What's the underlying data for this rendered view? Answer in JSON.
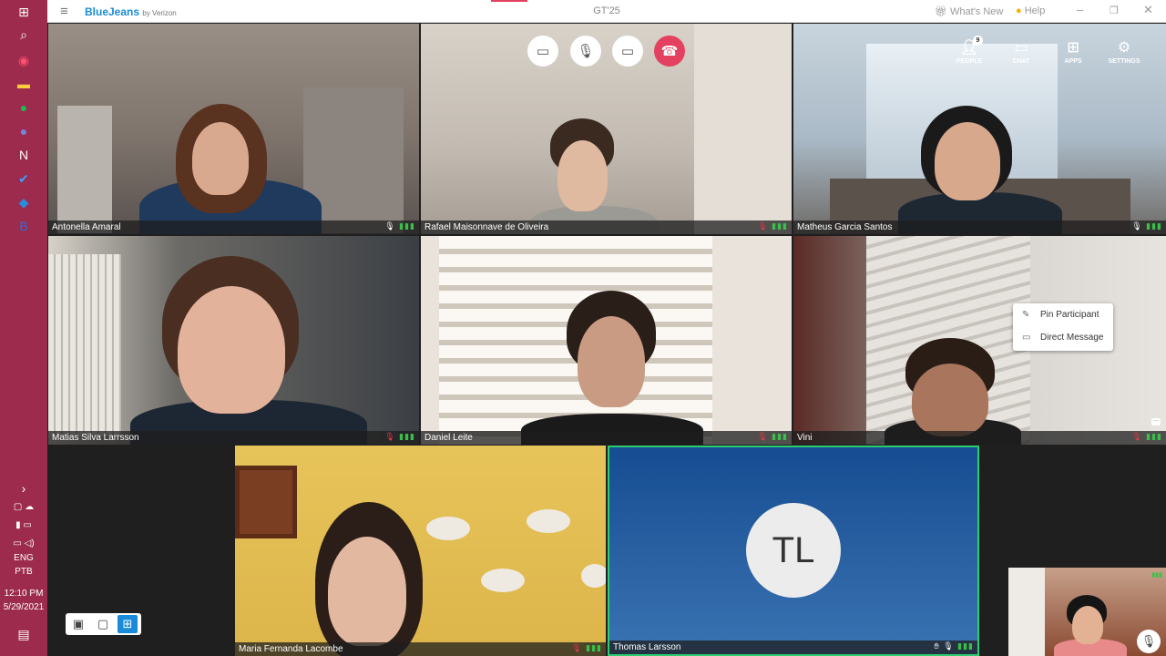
{
  "titlebar": {
    "brand": "BlueJeans",
    "brand_sub": "by Verizon",
    "meeting_title": "GT'25",
    "whats_new": "What's New",
    "help": "Help"
  },
  "controls": {
    "people_label": "PEOPLE",
    "people_count": "9",
    "chat_label": "CHAT",
    "apps_label": "APPS",
    "settings_label": "SETTINGS"
  },
  "participants": [
    {
      "name": "Antonella Amaral",
      "muted": false
    },
    {
      "name": "Rafael Maisonnave de Oliveira",
      "muted": true
    },
    {
      "name": "Matheus Garcia Santos",
      "muted": false
    },
    {
      "name": "Matias Silva Larrsson",
      "muted": true
    },
    {
      "name": "Daniel Leite",
      "muted": true
    },
    {
      "name": "Vini",
      "muted": true
    },
    {
      "name": "Maria Fernanda Lacombe",
      "muted": true
    },
    {
      "name": "Thomas Larsson",
      "initials": "TL",
      "muted": false
    }
  ],
  "context_menu": {
    "pin": "Pin Participant",
    "dm": "Direct Message"
  },
  "taskbar": {
    "lang1": "ENG",
    "lang2": "PTB",
    "time": "12:10 PM",
    "date": "5/29/2021"
  },
  "colors": {
    "taskbar": "#9c2b4d",
    "hangup": "#e4405f",
    "active_speaker_border": "#2ecc71",
    "avatar_bg": "#2a63a8"
  }
}
